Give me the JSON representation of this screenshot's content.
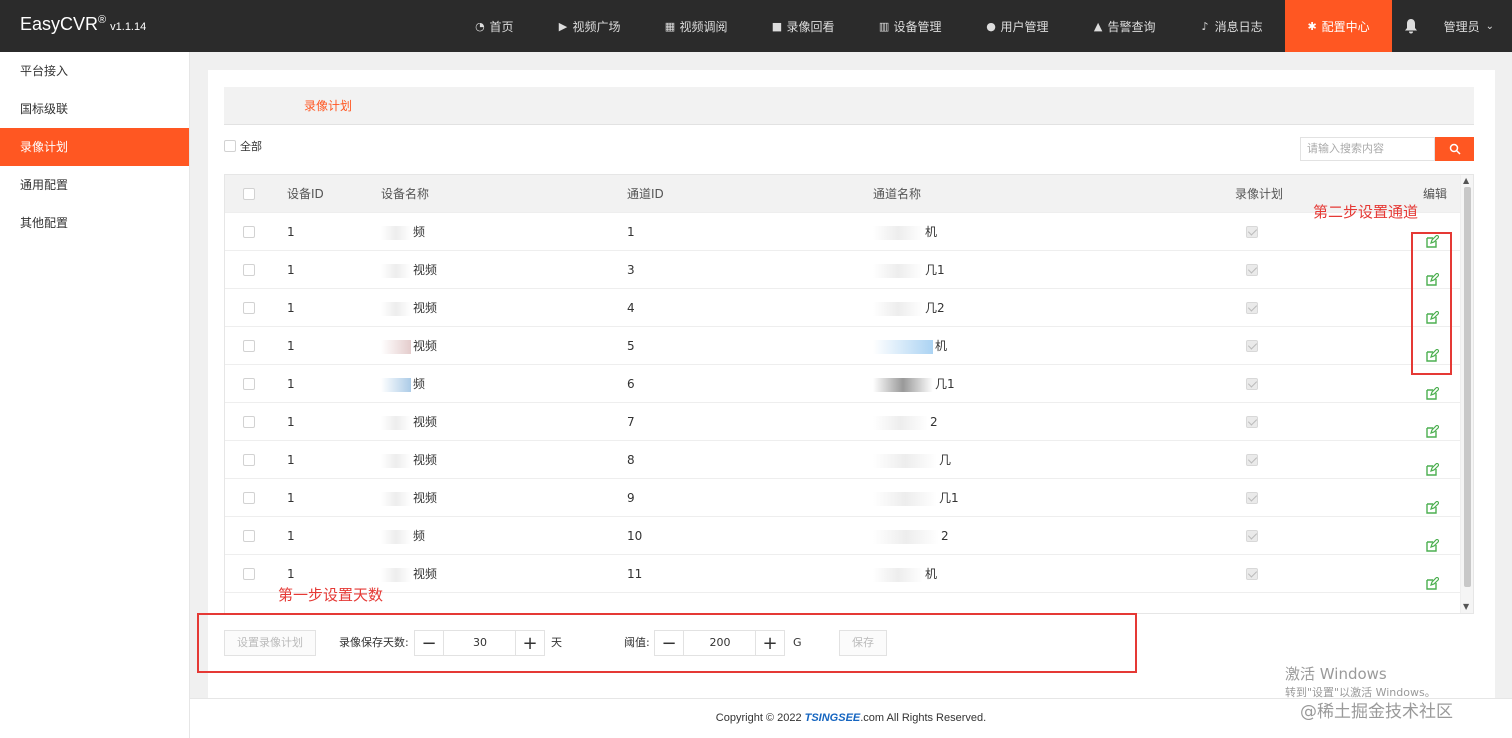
{
  "app": {
    "brand": "EasyCVR",
    "reg": "®",
    "version": "v1.1.14"
  },
  "nav": {
    "items": [
      {
        "label": "首页",
        "icon": "dashboard-icon"
      },
      {
        "label": "视频广场",
        "icon": "play-circle-icon"
      },
      {
        "label": "视频调阅",
        "icon": "grid-icon"
      },
      {
        "label": "录像回看",
        "icon": "video-camera-icon"
      },
      {
        "label": "设备管理",
        "icon": "columns-icon"
      },
      {
        "label": "用户管理",
        "icon": "user-icon"
      },
      {
        "label": "告警查询",
        "icon": "alarm-icon"
      },
      {
        "label": "消息日志",
        "icon": "bell-icon"
      },
      {
        "label": "配置中心",
        "icon": "gear-icon",
        "active": true
      }
    ],
    "user": "管理员"
  },
  "sidebar": {
    "items": [
      {
        "label": "平台接入"
      },
      {
        "label": "国标级联"
      },
      {
        "label": "录像计划",
        "active": true
      },
      {
        "label": "通用配置"
      },
      {
        "label": "其他配置"
      }
    ]
  },
  "main": {
    "tab": "录像计划",
    "select_all": "全部",
    "search_placeholder": "请输入搜索内容"
  },
  "table": {
    "headers": {
      "device_id": "设备ID",
      "device_name": "设备名称",
      "channel_id": "通道ID",
      "channel_name": "通道名称",
      "plan": "录像计划",
      "edit": "编辑"
    },
    "rows": [
      {
        "device_id": "1",
        "device_name": "频",
        "channel_id": "1",
        "channel_name": "机"
      },
      {
        "device_id": "1",
        "device_name": "视频",
        "channel_id": "3",
        "channel_name": "几1"
      },
      {
        "device_id": "1",
        "device_name": "视频",
        "channel_id": "4",
        "channel_name": "几2"
      },
      {
        "device_id": "1",
        "device_name": "视频",
        "channel_id": "5",
        "channel_name": "机"
      },
      {
        "device_id": "1",
        "device_name": "频",
        "channel_id": "6",
        "channel_name": "几1"
      },
      {
        "device_id": "1",
        "device_name": "视频",
        "channel_id": "7",
        "channel_name": "2"
      },
      {
        "device_id": "1",
        "device_name": "视频",
        "channel_id": "8",
        "channel_name": "几"
      },
      {
        "device_id": "1",
        "device_name": "视频",
        "channel_id": "9",
        "channel_name": "几1"
      },
      {
        "device_id": "1",
        "device_name": "频",
        "channel_id": "10",
        "channel_name": "2"
      },
      {
        "device_id": "1",
        "device_name": "视频",
        "channel_id": "11",
        "channel_name": "机"
      }
    ]
  },
  "annotations": {
    "step1": "第一步设置天数",
    "step2": "第二步设置通道",
    "highlight_color": "#e53935"
  },
  "form": {
    "set_plan_button": "设置录像计划",
    "days_label": "录像保存天数:",
    "days_value": "30",
    "days_unit": "天",
    "threshold_label": "阈值:",
    "threshold_value": "200",
    "threshold_unit": "G",
    "save_button": "保存"
  },
  "footer": {
    "copyright_prefix": "Copyright © 2022 ",
    "copyright_brand": "TSINGSEE",
    "copyright_suffix": ".com All Rights Reserved."
  },
  "watermark": {
    "activate_title": "激活 Windows",
    "activate_sub": "转到\"设置\"以激活 Windows。",
    "site": "@稀土掘金技术社区"
  },
  "colors": {
    "accent": "#ff5722",
    "topbar": "#2b2b2b",
    "edit_icon": "#4caf50"
  }
}
